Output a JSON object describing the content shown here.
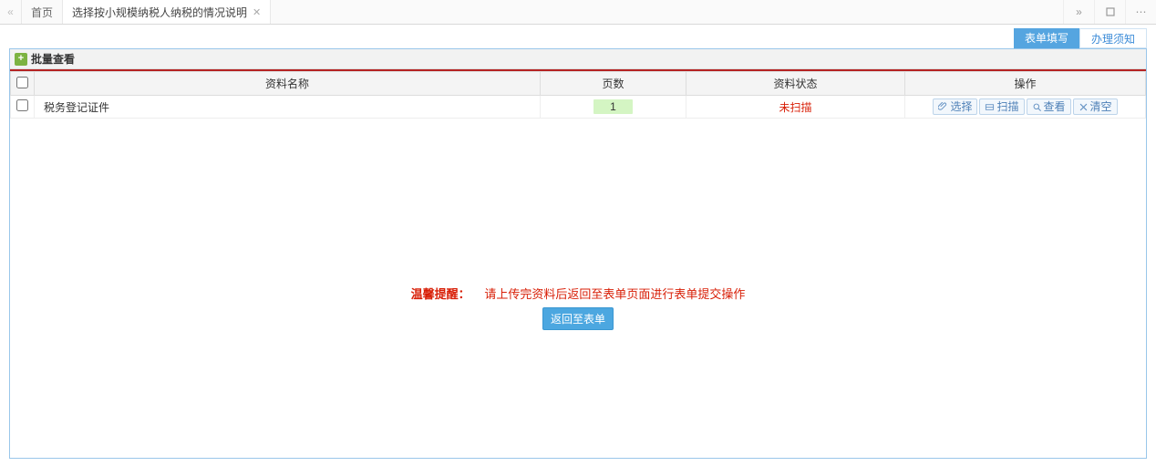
{
  "tabs": {
    "home": "首页",
    "active": "选择按小规模纳税人纳税的情况说明"
  },
  "toolbar": {
    "form_fill": "表单填写",
    "notice": "办理须知"
  },
  "panel": {
    "title": "批量查看"
  },
  "table": {
    "headers": {
      "name": "资料名称",
      "pages": "页数",
      "status": "资料状态",
      "ops": "操作"
    },
    "rows": [
      {
        "name": "税务登记证件",
        "pages": "1",
        "status": "未扫描"
      }
    ]
  },
  "ops": {
    "select": "选择",
    "scan": "扫描",
    "view": "查看",
    "clear": "清空"
  },
  "reminder": {
    "label": "温馨提醒：",
    "text": "请上传完资料后返回至表单页面进行表单提交操作"
  },
  "return_btn": "返回至表单"
}
